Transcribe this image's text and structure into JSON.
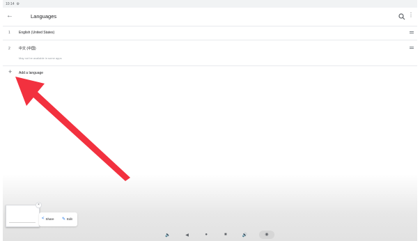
{
  "status_bar": {
    "time": "10:14",
    "indicator": "⚙"
  },
  "app_bar": {
    "title": "Languages",
    "back_icon": "arrow-back-icon",
    "search_icon": "search-icon",
    "more_icon": "more-vert-icon"
  },
  "languages": [
    {
      "number": "1",
      "name": "English (United States)",
      "subtitle": ""
    },
    {
      "number": "2",
      "name": "中文 (中国)",
      "subtitle": "May not be available in some apps"
    }
  ],
  "add_language": {
    "label": "Add a language",
    "icon": "plus-icon"
  },
  "screenshot_toolbar": {
    "share_label": "Share",
    "edit_label": "Edit",
    "close_symbol": "×"
  },
  "nav_bar": {
    "items": [
      {
        "icon": "volume-down-icon",
        "glyph": "🔈"
      },
      {
        "icon": "back-icon",
        "glyph": "◀"
      },
      {
        "icon": "home-icon",
        "glyph": "●"
      },
      {
        "icon": "recents-icon",
        "glyph": "■"
      },
      {
        "icon": "volume-up-icon",
        "glyph": "🔊"
      },
      {
        "icon": "screenshot-icon",
        "glyph": "◉"
      }
    ]
  },
  "colors": {
    "annotation_arrow": "#f2313f",
    "accent": "#1a73e8"
  }
}
